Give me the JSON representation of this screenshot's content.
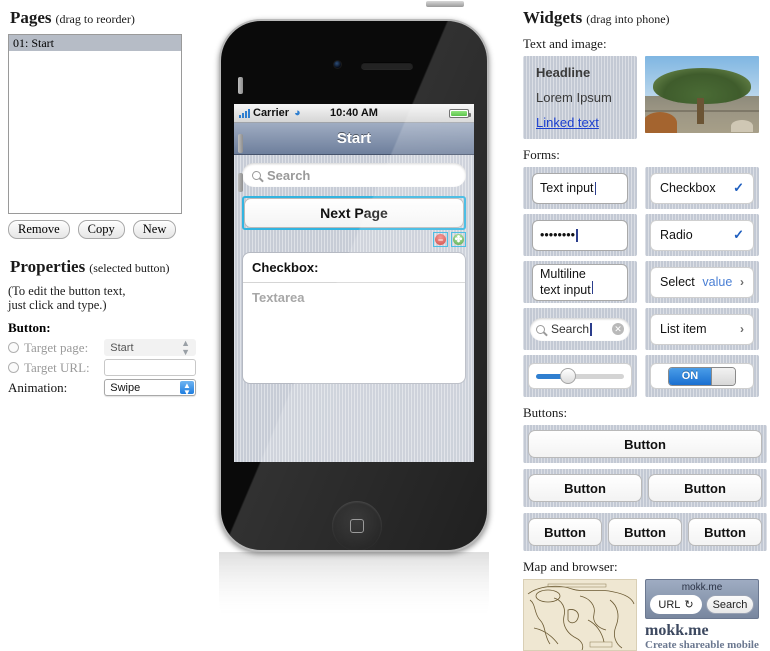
{
  "left": {
    "pages": {
      "title": "Pages",
      "hint": "(drag to reorder)",
      "items": [
        {
          "label": "01: Start",
          "selected": true
        }
      ],
      "buttons": [
        "Remove",
        "Copy",
        "New"
      ]
    },
    "properties": {
      "title": "Properties",
      "hint": "(selected button)",
      "note_line1": "(To edit the button text,",
      "note_line2": "just click and type.)",
      "button_label": "Button:",
      "target_page_label": "Target page:",
      "target_page_value": "Start",
      "target_url_label": "Target URL:",
      "target_url_value": "",
      "animation_label": "Animation:",
      "animation_value": "Swipe"
    }
  },
  "phone": {
    "statusbar": {
      "carrier": "Carrier",
      "time": "10:40 AM"
    },
    "title": "Start",
    "search_placeholder": "Search",
    "next_page_button": "Next Page",
    "card_heading": "Checkbox:",
    "card_placeholder": "Textarea",
    "badges": {
      "delete": "−",
      "move": "✤"
    }
  },
  "widgets": {
    "title": "Widgets",
    "hint": "(drag into phone)",
    "sections": {
      "text_and_image": "Text and image:",
      "forms": "Forms:",
      "buttons": "Buttons:",
      "map_and_browser": "Map and browser:"
    },
    "text_items": [
      {
        "label": "Headline",
        "style": "head"
      },
      {
        "label": "Lorem Ipsum",
        "style": "body"
      },
      {
        "label": "Linked text",
        "style": "link"
      }
    ],
    "forms": {
      "text_input": "Text input",
      "password": "••••••••",
      "multiline_1": "Multiline",
      "multiline_2": "text input",
      "search": "Search",
      "checkbox": "Checkbox",
      "checkbox_mark": "✓",
      "radio": "Radio",
      "radio_mark": "✓",
      "select": "Select",
      "select_value": "value",
      "select_chevron": "›",
      "list_item": "List item",
      "list_chevron": "›",
      "toggle": "ON"
    },
    "buttons": {
      "row1": [
        "Button"
      ],
      "row2": [
        "Button",
        "Button"
      ],
      "row3": [
        "Button",
        "Button",
        "Button"
      ]
    },
    "browser": {
      "title": "mokk.me",
      "url_label": "URL",
      "reload_glyph": "↻",
      "search_label": "Search",
      "brand": "mokk.me",
      "tagline": "Create shareable mobile"
    }
  }
}
